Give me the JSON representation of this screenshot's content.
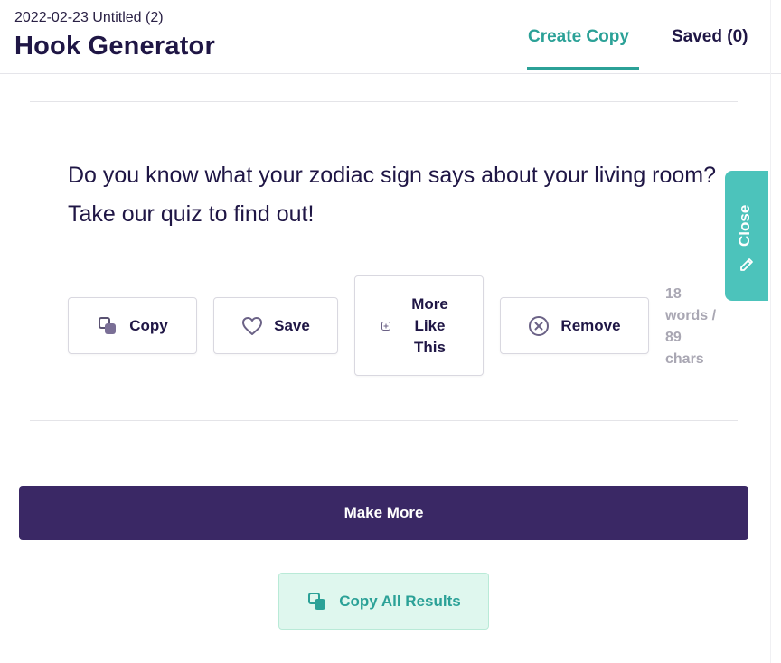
{
  "header": {
    "doc_meta": "2022-02-23 Untitled (2)",
    "title": "Hook Generator",
    "tabs": {
      "create": "Create Copy",
      "saved": "Saved (0)"
    },
    "accent_color": "#2ba197"
  },
  "result": {
    "text": "Do you know what your zodiac sign says about your living room? Take our quiz to find out!",
    "actions": {
      "copy": "Copy",
      "save": "Save",
      "more_like_this": "More Like This",
      "remove": "Remove"
    },
    "stats": "18 words / 89 chars"
  },
  "footer": {
    "make_more": "Make More",
    "copy_all": "Copy All Results",
    "primary_color": "#3a2865"
  },
  "side_tab": {
    "close_label": "Close",
    "color": "#4cc3bb",
    "icon": "pencil-icon"
  },
  "icons": {
    "copy": "copy-icon",
    "save": "heart-icon",
    "more": "plus-square-icon",
    "remove": "x-circle-icon",
    "copy_all": "copy-icon"
  }
}
